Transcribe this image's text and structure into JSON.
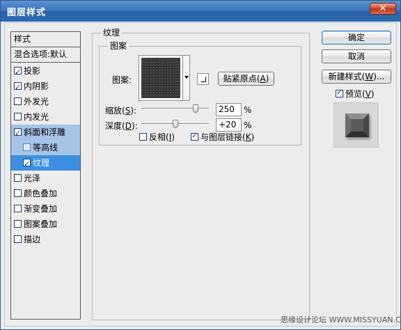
{
  "window": {
    "title": "图层样式",
    "close_glyph": "✕"
  },
  "sidebar": {
    "header_styles": "样式",
    "header_blend": "混合选项:默认",
    "items": [
      {
        "label": "投影",
        "checked": true
      },
      {
        "label": "内阴影",
        "checked": true
      },
      {
        "label": "外发光",
        "checked": false
      },
      {
        "label": "内发光",
        "checked": false
      },
      {
        "label": "斜面和浮雕",
        "checked": true
      },
      {
        "label": "等高线",
        "checked": false
      },
      {
        "label": "纹理",
        "checked": true
      },
      {
        "label": "光泽",
        "checked": false
      },
      {
        "label": "颜色叠加",
        "checked": false
      },
      {
        "label": "渐变叠加",
        "checked": false
      },
      {
        "label": "图案叠加",
        "checked": false
      },
      {
        "label": "描边",
        "checked": false
      }
    ]
  },
  "texture_panel": {
    "group_title": "纹理",
    "subgroup_title": "图案",
    "pattern_label": "图案:",
    "snap_origin": {
      "text": "贴紧原点(",
      "key": "A",
      "suffix": ")"
    },
    "scale": {
      "text": "缩放(",
      "key": "S",
      "suffix": "):",
      "value": "250",
      "unit": "%",
      "level": 250
    },
    "depth": {
      "text": "深度(",
      "key": "D",
      "suffix": "):",
      "value": "+20",
      "unit": "%",
      "level": 20
    },
    "invert": {
      "text": "反相(",
      "key": "I",
      "suffix": ")",
      "checked": false
    },
    "link": {
      "text": "与图层链接(",
      "key": "K",
      "suffix": ")",
      "checked": true
    }
  },
  "buttons": {
    "ok": "确定",
    "cancel": "取消",
    "new_style": {
      "text": "新建样式(",
      "key": "W",
      "suffix": ")..."
    },
    "preview": {
      "text": "预览(",
      "key": "V",
      "suffix": ")",
      "checked": true
    }
  },
  "watermark": "思缘设计论坛 WWW.MISSYUAN.COM"
}
